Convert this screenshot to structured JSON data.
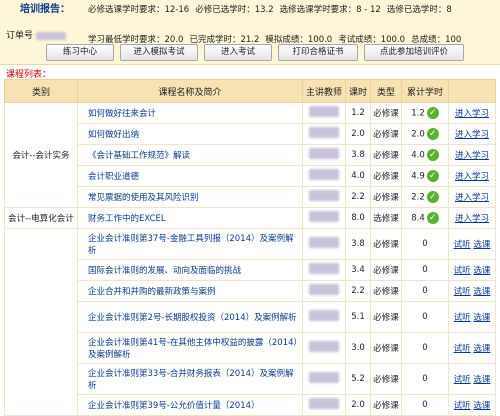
{
  "header": {
    "title": "培训报告：",
    "order_label": "订单号",
    "stats_row1": [
      "必修选课学时要求：12-16",
      "必修已选学时：13.2",
      "选修选课学时要求：8 - 12",
      "选修已选学时：8"
    ],
    "stats_row2": [
      "学习最低学时要求：20.0",
      "已完成学时：21.2",
      "模拟成绩：100.0",
      "考试成绩：100.0",
      "总成绩：100"
    ]
  },
  "buttons": [
    "练习中心",
    "进入模拟考试",
    "进入考试",
    "打印合格证书",
    "点此参加培训评价"
  ],
  "course_list_label": "课程列表：",
  "table": {
    "headers": [
      "类别",
      "课程名称及简介",
      "主讲教师",
      "课时",
      "类型",
      "累计学时",
      ""
    ],
    "groups": [
      {
        "category": "会计--会计实务",
        "rows": [
          {
            "name": "如何做好往来会计",
            "hours": "1.2",
            "type": "必修课",
            "acc": "1.2",
            "done": true,
            "action": "进入学习"
          },
          {
            "name": "如何做好出纳",
            "hours": "2.0",
            "type": "必修课",
            "acc": "2.0",
            "done": true,
            "action": "进入学习"
          },
          {
            "name": "《会计基础工作规范》解读",
            "hours": "3.8",
            "type": "必修课",
            "acc": "4.0",
            "done": true,
            "action": "进入学习"
          },
          {
            "name": "会计职业道德",
            "hours": "4.0",
            "type": "必修课",
            "acc": "4.9",
            "done": true,
            "action": "进入学习"
          },
          {
            "name": "常见票据的使用及其风险识别",
            "hours": "2.2",
            "type": "必修课",
            "acc": "2.2",
            "done": true,
            "action": "进入学习"
          }
        ]
      },
      {
        "category": "会计--电算化会计",
        "rows": [
          {
            "name": "财务工作中的EXCEL",
            "hours": "8.0",
            "type": "选修课",
            "acc": "8.4",
            "done": true,
            "action": "进入学习"
          }
        ]
      }
    ],
    "other_rows": [
      {
        "name": "企业会计准则第37号-金融工具列报（2014）及案例解析",
        "hours": "3.8",
        "type": "必修课",
        "acc": "0",
        "a1": "试听",
        "a2": "选课",
        "tall": true
      },
      {
        "name": "国际会计准则的发展、动向及面临的挑战",
        "hours": "3.4",
        "type": "必修课",
        "acc": "0",
        "a1": "试听",
        "a2": "选课",
        "tall": false
      },
      {
        "name": "企业合并和并购的最新政策与案例",
        "hours": "2.2",
        "type": "必修课",
        "acc": "0",
        "a1": "试听",
        "a2": "选课",
        "tall": false
      },
      {
        "name": "企业会计准则第2号-长期股权投资（2014）及案例解析",
        "hours": "5.1",
        "type": "必修课",
        "acc": "0",
        "a1": "试听",
        "a2": "选课",
        "tall": true
      },
      {
        "name": "企业会计准则第41号-在其他主体中权益的披露（2014）及案例解析",
        "hours": "3.0",
        "type": "必修课",
        "acc": "0",
        "a1": "试听",
        "a2": "选课",
        "tall": true
      },
      {
        "name": "企业会计准则第33号-合并财务报表（2014）及案例解析",
        "hours": "5.2",
        "type": "必修课",
        "acc": "0",
        "a1": "试听",
        "a2": "选课",
        "tall": true
      },
      {
        "name": "企业会计准则第39号-公允价值计量（2014）",
        "hours": "2.0",
        "type": "必修课",
        "acc": "0",
        "a1": "试听",
        "a2": "选课",
        "tall": false
      }
    ]
  },
  "colors": {
    "accent_blue": "#0b3a8c",
    "header_bg": "#fdf6d8",
    "table_head": "#f7e2b4",
    "check_green": "#5cb030",
    "label_red": "#cc0000"
  }
}
